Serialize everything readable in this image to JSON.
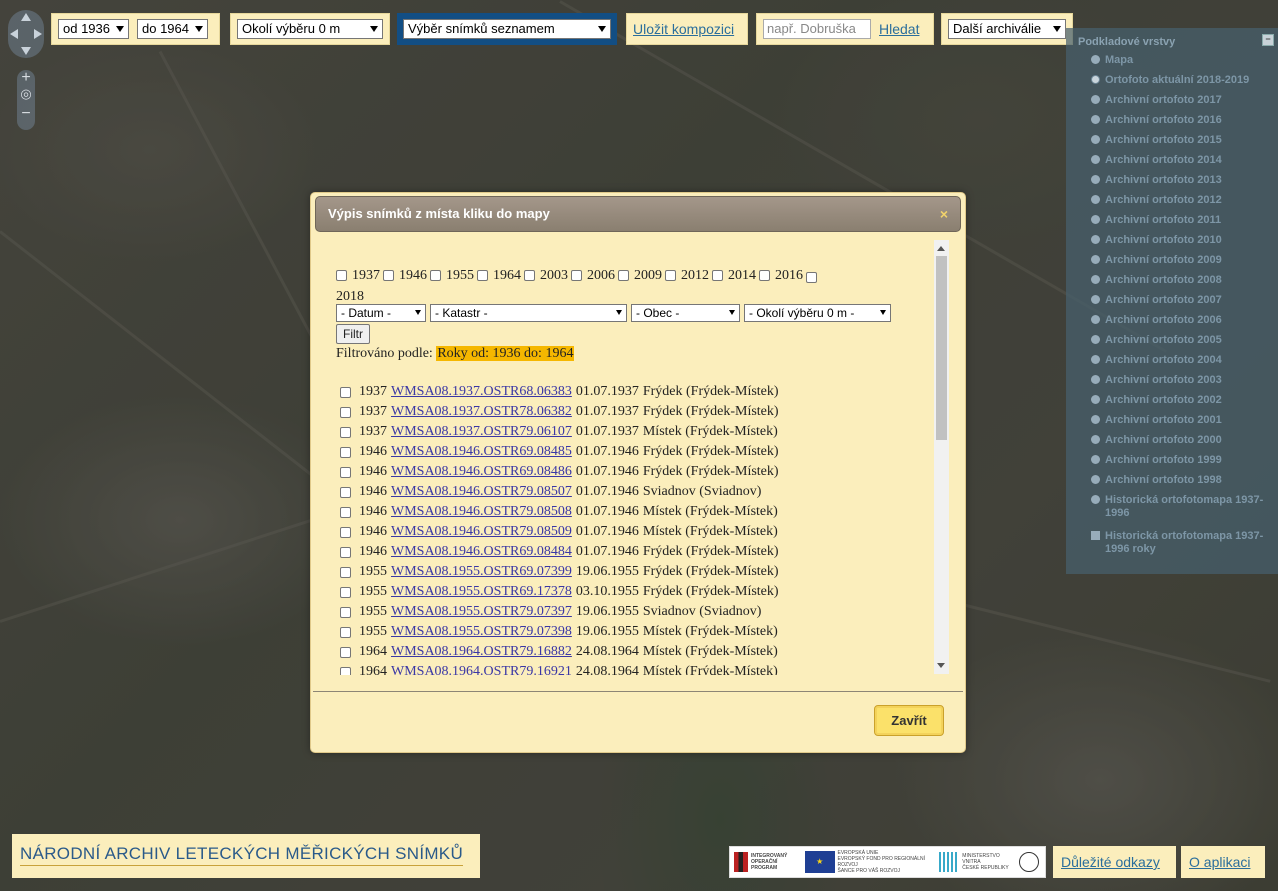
{
  "toolbar": {
    "year_from": "od 1936",
    "year_to": "do 1964",
    "radius": "Okolí výběru 0 m",
    "mode": "Výběr snímků seznamem",
    "save_composition": "Uložit kompozici",
    "search_placeholder": "např. Dobruška",
    "search_button": "Hledat",
    "more_archives": "Další archiválie"
  },
  "layers": {
    "title": "Podkladové vrstvy",
    "collapse": "−",
    "items": [
      {
        "label": "Mapa"
      },
      {
        "label": "Ortofoto aktuální 2018-2019"
      },
      {
        "label": "Archivní ortofoto 2017"
      },
      {
        "label": "Archivní ortofoto 2016"
      },
      {
        "label": "Archivní ortofoto 2015"
      },
      {
        "label": "Archivní ortofoto 2014"
      },
      {
        "label": "Archivní ortofoto 2013"
      },
      {
        "label": "Archivní ortofoto 2012"
      },
      {
        "label": "Archivní ortofoto 2011"
      },
      {
        "label": "Archivní ortofoto 2010"
      },
      {
        "label": "Archivní ortofoto 2009"
      },
      {
        "label": "Archivní ortofoto 2008"
      },
      {
        "label": "Archivní ortofoto 2007"
      },
      {
        "label": "Archivní ortofoto 2006"
      },
      {
        "label": "Archivní ortofoto 2005"
      },
      {
        "label": "Archivní ortofoto 2004"
      },
      {
        "label": "Archivní ortofoto 2003"
      },
      {
        "label": "Archivní ortofoto 2002"
      },
      {
        "label": "Archivní ortofoto 2001"
      },
      {
        "label": "Archivní ortofoto 2000"
      },
      {
        "label": "Archivní ortofoto 1999"
      },
      {
        "label": "Archivní ortofoto 1998"
      },
      {
        "label": "Historická ortofotomapa 1937-1996"
      }
    ],
    "checkbox_item": "Historická ortofotomapa 1937-1996 roky"
  },
  "dialog": {
    "title": "Výpis snímků z místa kliku do mapy",
    "close_icon": "×",
    "years": [
      "1937",
      "1946",
      "1955",
      "1964",
      "2003",
      "2006",
      "2009",
      "2012",
      "2014",
      "2016",
      "2018"
    ],
    "filter_date": "- Datum -",
    "filter_cadastre": "- Katastr -",
    "filter_municipality": "- Obec -",
    "filter_radius": "- Okolí výběru 0 m -",
    "filter_button": "Filtr",
    "filtered_by_label": "Filtrováno podle:",
    "filtered_by_value": "Roky od: 1936 do: 1964",
    "rows": [
      {
        "year": "1937",
        "id": "WMSA08.1937.OSTR68.06383",
        "date": "01.07.1937",
        "place": "Frýdek (Frýdek-Místek)"
      },
      {
        "year": "1937",
        "id": "WMSA08.1937.OSTR78.06382",
        "date": "01.07.1937",
        "place": "Frýdek (Frýdek-Místek)"
      },
      {
        "year": "1937",
        "id": "WMSA08.1937.OSTR79.06107",
        "date": "01.07.1937",
        "place": "Místek (Frýdek-Místek)"
      },
      {
        "year": "1946",
        "id": "WMSA08.1946.OSTR69.08485",
        "date": "01.07.1946",
        "place": "Frýdek (Frýdek-Místek)"
      },
      {
        "year": "1946",
        "id": "WMSA08.1946.OSTR69.08486",
        "date": "01.07.1946",
        "place": "Frýdek (Frýdek-Místek)"
      },
      {
        "year": "1946",
        "id": "WMSA08.1946.OSTR79.08507",
        "date": "01.07.1946",
        "place": "Sviadnov (Sviadnov)"
      },
      {
        "year": "1946",
        "id": "WMSA08.1946.OSTR79.08508",
        "date": "01.07.1946",
        "place": "Místek (Frýdek-Místek)"
      },
      {
        "year": "1946",
        "id": "WMSA08.1946.OSTR79.08509",
        "date": "01.07.1946",
        "place": "Místek (Frýdek-Místek)"
      },
      {
        "year": "1946",
        "id": "WMSA08.1946.OSTR69.08484",
        "date": "01.07.1946",
        "place": "Frýdek (Frýdek-Místek)"
      },
      {
        "year": "1955",
        "id": "WMSA08.1955.OSTR69.07399",
        "date": "19.06.1955",
        "place": "Frýdek (Frýdek-Místek)"
      },
      {
        "year": "1955",
        "id": "WMSA08.1955.OSTR69.17378",
        "date": "03.10.1955",
        "place": "Frýdek (Frýdek-Místek)"
      },
      {
        "year": "1955",
        "id": "WMSA08.1955.OSTR79.07397",
        "date": "19.06.1955",
        "place": "Sviadnov (Sviadnov)"
      },
      {
        "year": "1955",
        "id": "WMSA08.1955.OSTR79.07398",
        "date": "19.06.1955",
        "place": "Místek (Frýdek-Místek)"
      },
      {
        "year": "1964",
        "id": "WMSA08.1964.OSTR79.16882",
        "date": "24.08.1964",
        "place": "Místek (Frýdek-Místek)"
      },
      {
        "year": "1964",
        "id": "WMSA08.1964.OSTR79.16921",
        "date": "24.08.1964",
        "place": "Místek (Frýdek-Místek)"
      }
    ],
    "close_button": "Zavřít"
  },
  "footer": {
    "brand": "NÁRODNÍ ARCHIV LETECKÝCH MĚŘICKÝCH SNÍMKŮ",
    "logos_op": "INTEGROVANÝ OPERAČNÍ PROGRAM",
    "logos_eu": "EVROPSKÁ UNIE EVROPSKÝ FOND PRO REGIONÁLNÍ ROZVOJ ŠANCE PRO VÁŠ ROZVOJ",
    "logos_mv": "MINISTERSTVO VNITRA ČESKÉ REPUBLIKY",
    "important_links": "Důležité odkazy",
    "about": "O aplikaci"
  },
  "icons": {
    "pan_up": "pan-up-icon",
    "pan_down": "pan-down-icon",
    "pan_left": "pan-left-icon",
    "pan_right": "pan-right-icon",
    "zoom_in": "+",
    "zoom_world": "world-icon",
    "zoom_out": "−"
  },
  "colors": {
    "panel_bg": "#fbeebc",
    "link": "#2a6e9c",
    "highlight": "#f5b700",
    "mode_frame": "#124e84"
  }
}
